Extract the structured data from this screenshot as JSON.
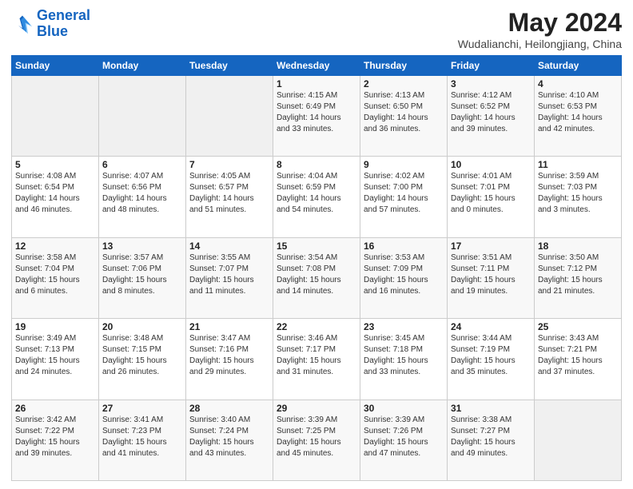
{
  "logo": {
    "line1": "General",
    "line2": "Blue"
  },
  "title": "May 2024",
  "subtitle": "Wudalianchi, Heilongjiang, China",
  "days_of_week": [
    "Sunday",
    "Monday",
    "Tuesday",
    "Wednesday",
    "Thursday",
    "Friday",
    "Saturday"
  ],
  "weeks": [
    [
      {
        "day": "",
        "sunrise": "",
        "sunset": "",
        "daylight": ""
      },
      {
        "day": "",
        "sunrise": "",
        "sunset": "",
        "daylight": ""
      },
      {
        "day": "",
        "sunrise": "",
        "sunset": "",
        "daylight": ""
      },
      {
        "day": "1",
        "sunrise": "Sunrise: 4:15 AM",
        "sunset": "Sunset: 6:49 PM",
        "daylight": "Daylight: 14 hours and 33 minutes."
      },
      {
        "day": "2",
        "sunrise": "Sunrise: 4:13 AM",
        "sunset": "Sunset: 6:50 PM",
        "daylight": "Daylight: 14 hours and 36 minutes."
      },
      {
        "day": "3",
        "sunrise": "Sunrise: 4:12 AM",
        "sunset": "Sunset: 6:52 PM",
        "daylight": "Daylight: 14 hours and 39 minutes."
      },
      {
        "day": "4",
        "sunrise": "Sunrise: 4:10 AM",
        "sunset": "Sunset: 6:53 PM",
        "daylight": "Daylight: 14 hours and 42 minutes."
      }
    ],
    [
      {
        "day": "5",
        "sunrise": "Sunrise: 4:08 AM",
        "sunset": "Sunset: 6:54 PM",
        "daylight": "Daylight: 14 hours and 46 minutes."
      },
      {
        "day": "6",
        "sunrise": "Sunrise: 4:07 AM",
        "sunset": "Sunset: 6:56 PM",
        "daylight": "Daylight: 14 hours and 48 minutes."
      },
      {
        "day": "7",
        "sunrise": "Sunrise: 4:05 AM",
        "sunset": "Sunset: 6:57 PM",
        "daylight": "Daylight: 14 hours and 51 minutes."
      },
      {
        "day": "8",
        "sunrise": "Sunrise: 4:04 AM",
        "sunset": "Sunset: 6:59 PM",
        "daylight": "Daylight: 14 hours and 54 minutes."
      },
      {
        "day": "9",
        "sunrise": "Sunrise: 4:02 AM",
        "sunset": "Sunset: 7:00 PM",
        "daylight": "Daylight: 14 hours and 57 minutes."
      },
      {
        "day": "10",
        "sunrise": "Sunrise: 4:01 AM",
        "sunset": "Sunset: 7:01 PM",
        "daylight": "Daylight: 15 hours and 0 minutes."
      },
      {
        "day": "11",
        "sunrise": "Sunrise: 3:59 AM",
        "sunset": "Sunset: 7:03 PM",
        "daylight": "Daylight: 15 hours and 3 minutes."
      }
    ],
    [
      {
        "day": "12",
        "sunrise": "Sunrise: 3:58 AM",
        "sunset": "Sunset: 7:04 PM",
        "daylight": "Daylight: 15 hours and 6 minutes."
      },
      {
        "day": "13",
        "sunrise": "Sunrise: 3:57 AM",
        "sunset": "Sunset: 7:06 PM",
        "daylight": "Daylight: 15 hours and 8 minutes."
      },
      {
        "day": "14",
        "sunrise": "Sunrise: 3:55 AM",
        "sunset": "Sunset: 7:07 PM",
        "daylight": "Daylight: 15 hours and 11 minutes."
      },
      {
        "day": "15",
        "sunrise": "Sunrise: 3:54 AM",
        "sunset": "Sunset: 7:08 PM",
        "daylight": "Daylight: 15 hours and 14 minutes."
      },
      {
        "day": "16",
        "sunrise": "Sunrise: 3:53 AM",
        "sunset": "Sunset: 7:09 PM",
        "daylight": "Daylight: 15 hours and 16 minutes."
      },
      {
        "day": "17",
        "sunrise": "Sunrise: 3:51 AM",
        "sunset": "Sunset: 7:11 PM",
        "daylight": "Daylight: 15 hours and 19 minutes."
      },
      {
        "day": "18",
        "sunrise": "Sunrise: 3:50 AM",
        "sunset": "Sunset: 7:12 PM",
        "daylight": "Daylight: 15 hours and 21 minutes."
      }
    ],
    [
      {
        "day": "19",
        "sunrise": "Sunrise: 3:49 AM",
        "sunset": "Sunset: 7:13 PM",
        "daylight": "Daylight: 15 hours and 24 minutes."
      },
      {
        "day": "20",
        "sunrise": "Sunrise: 3:48 AM",
        "sunset": "Sunset: 7:15 PM",
        "daylight": "Daylight: 15 hours and 26 minutes."
      },
      {
        "day": "21",
        "sunrise": "Sunrise: 3:47 AM",
        "sunset": "Sunset: 7:16 PM",
        "daylight": "Daylight: 15 hours and 29 minutes."
      },
      {
        "day": "22",
        "sunrise": "Sunrise: 3:46 AM",
        "sunset": "Sunset: 7:17 PM",
        "daylight": "Daylight: 15 hours and 31 minutes."
      },
      {
        "day": "23",
        "sunrise": "Sunrise: 3:45 AM",
        "sunset": "Sunset: 7:18 PM",
        "daylight": "Daylight: 15 hours and 33 minutes."
      },
      {
        "day": "24",
        "sunrise": "Sunrise: 3:44 AM",
        "sunset": "Sunset: 7:19 PM",
        "daylight": "Daylight: 15 hours and 35 minutes."
      },
      {
        "day": "25",
        "sunrise": "Sunrise: 3:43 AM",
        "sunset": "Sunset: 7:21 PM",
        "daylight": "Daylight: 15 hours and 37 minutes."
      }
    ],
    [
      {
        "day": "26",
        "sunrise": "Sunrise: 3:42 AM",
        "sunset": "Sunset: 7:22 PM",
        "daylight": "Daylight: 15 hours and 39 minutes."
      },
      {
        "day": "27",
        "sunrise": "Sunrise: 3:41 AM",
        "sunset": "Sunset: 7:23 PM",
        "daylight": "Daylight: 15 hours and 41 minutes."
      },
      {
        "day": "28",
        "sunrise": "Sunrise: 3:40 AM",
        "sunset": "Sunset: 7:24 PM",
        "daylight": "Daylight: 15 hours and 43 minutes."
      },
      {
        "day": "29",
        "sunrise": "Sunrise: 3:39 AM",
        "sunset": "Sunset: 7:25 PM",
        "daylight": "Daylight: 15 hours and 45 minutes."
      },
      {
        "day": "30",
        "sunrise": "Sunrise: 3:39 AM",
        "sunset": "Sunset: 7:26 PM",
        "daylight": "Daylight: 15 hours and 47 minutes."
      },
      {
        "day": "31",
        "sunrise": "Sunrise: 3:38 AM",
        "sunset": "Sunset: 7:27 PM",
        "daylight": "Daylight: 15 hours and 49 minutes."
      },
      {
        "day": "",
        "sunrise": "",
        "sunset": "",
        "daylight": ""
      }
    ]
  ]
}
